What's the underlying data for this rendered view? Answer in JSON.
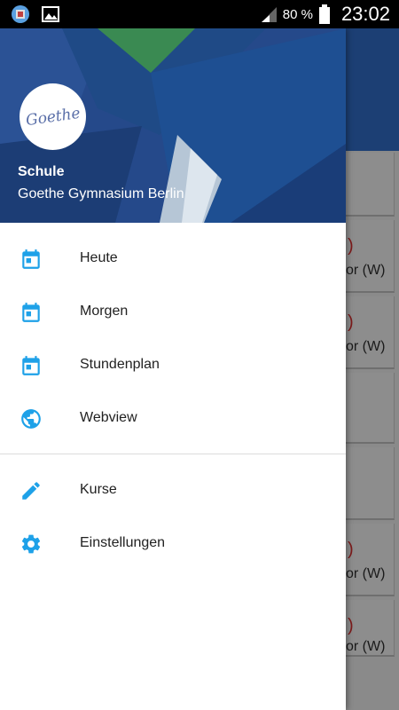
{
  "status_bar": {
    "battery_percent": "80 %",
    "time": "23:02",
    "left_icons": [
      "app-notification-icon",
      "image-icon"
    ],
    "right_icons": [
      "signal-icon",
      "battery-icon"
    ]
  },
  "drawer": {
    "header": {
      "avatar_text": "Goethe",
      "title": "Schule",
      "subtitle": "Goethe Gymnasium Berlin"
    },
    "menu_group_1": [
      {
        "label": "Heute",
        "icon": "calendar-icon"
      },
      {
        "label": "Morgen",
        "icon": "calendar-icon"
      },
      {
        "label": "Stundenplan",
        "icon": "calendar-icon"
      },
      {
        "label": "Webview",
        "icon": "globe-icon"
      }
    ],
    "menu_group_2": [
      {
        "label": "Kurse",
        "icon": "pencil-icon"
      },
      {
        "label": "Einstellungen",
        "icon": "gear-icon"
      }
    ]
  },
  "background_cards": [
    {
      "red": ")",
      "text": "or (W)"
    },
    {
      "red": ")",
      "text": "or (W)"
    },
    {
      "red": ")",
      "text": "or (W)"
    },
    {
      "red": ")",
      "text": "or (W)"
    }
  ],
  "colors": {
    "accent": "#1ea1e8",
    "header_bg": "#23467f",
    "app_bar": "#1c3f74"
  }
}
